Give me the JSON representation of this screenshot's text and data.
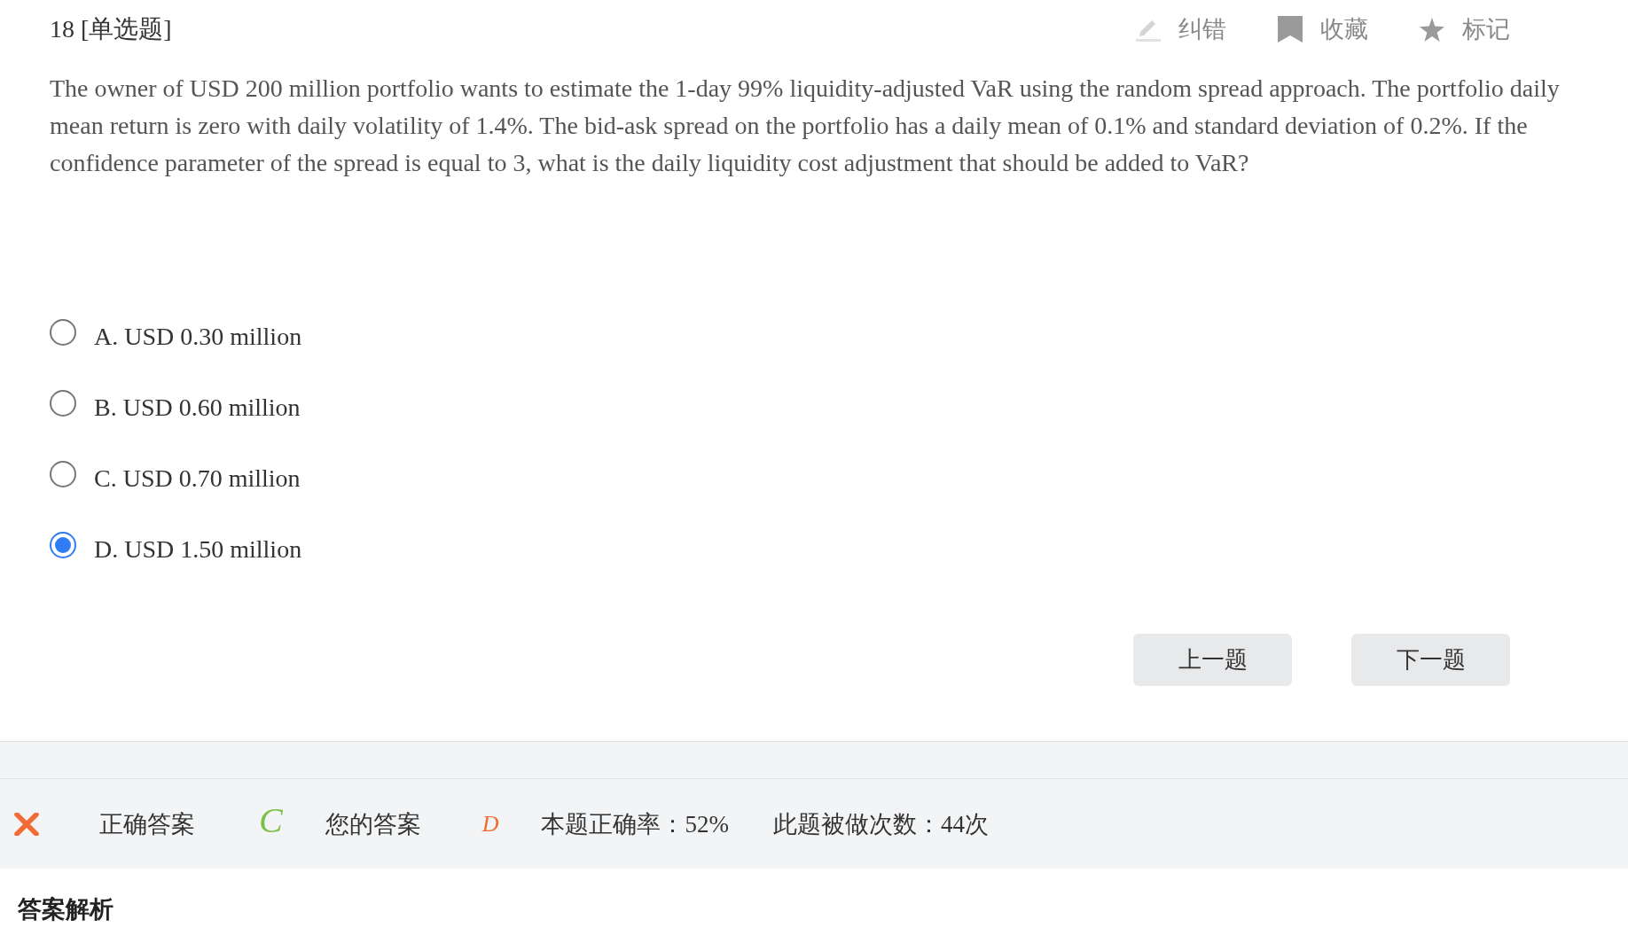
{
  "header": {
    "title": "18 [单选题]",
    "actions": [
      "纠错",
      "收藏",
      "标记"
    ]
  },
  "question": "The owner of USD 200 million portfolio wants to estimate the 1-day 99% liquidity-adjusted VaR using the random spread approach. The portfolio daily mean return is zero with daily volatility of 1.4%. The bid-ask spread on the portfolio has a daily mean of 0.1% and standard deviation of 0.2%. If the confidence parameter of the spread is equal to 3, what is the daily liquidity cost adjustment that should be added to VaR?",
  "options": [
    {
      "label": "A. USD 0.30 million",
      "selected": false
    },
    {
      "label": "B. USD 0.60 million",
      "selected": false
    },
    {
      "label": "C. USD 0.70 million",
      "selected": false
    },
    {
      "label": "D. USD 1.50 million",
      "selected": true
    }
  ],
  "nav_buttons": [
    "上一题",
    "下一题"
  ],
  "result": {
    "correct": false,
    "correct_answer_label": "正确答案",
    "correct_answer": "C",
    "your_answer_label": "您的答案",
    "your_answer": "D",
    "accuracy": "本题正确率：52%",
    "attempts": "此题被做次数：44次"
  },
  "analysis": {
    "heading": "答案解析"
  }
}
